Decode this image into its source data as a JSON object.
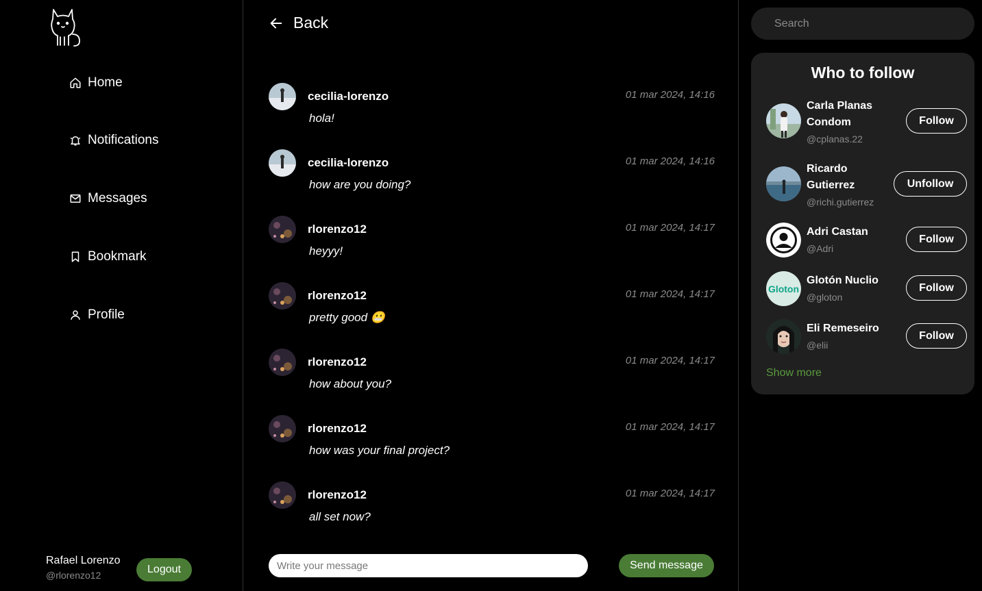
{
  "sidebar": {
    "nav": [
      {
        "label": "Home",
        "icon": "home-icon"
      },
      {
        "label": "Notifications",
        "icon": "bell-icon"
      },
      {
        "label": "Messages",
        "icon": "envelope-icon"
      },
      {
        "label": "Bookmark",
        "icon": "bookmark-icon"
      },
      {
        "label": "Profile",
        "icon": "user-icon"
      }
    ],
    "user": {
      "name": "Rafael Lorenzo",
      "handle": "@rlorenzo12"
    },
    "logout_label": "Logout"
  },
  "chat": {
    "back_label": "Back",
    "messages": [
      {
        "author": "cecilia-lorenzo",
        "time": "01 mar 2024, 14:16",
        "text": "hola!"
      },
      {
        "author": "cecilia-lorenzo",
        "time": "01 mar 2024, 14:16",
        "text": "how are you doing?"
      },
      {
        "author": "rlorenzo12",
        "time": "01 mar 2024, 14:17",
        "text": "heyyy!"
      },
      {
        "author": "rlorenzo12",
        "time": "01 mar 2024, 14:17",
        "text": "pretty good 😬"
      },
      {
        "author": "rlorenzo12",
        "time": "01 mar 2024, 14:17",
        "text": "how about you?"
      },
      {
        "author": "rlorenzo12",
        "time": "01 mar 2024, 14:17",
        "text": "how was your final project?"
      },
      {
        "author": "rlorenzo12",
        "time": "01 mar 2024, 14:17",
        "text": "all set now?"
      }
    ],
    "composer_placeholder": "Write your message",
    "send_label": "Send message"
  },
  "right": {
    "search_placeholder": "Search",
    "who_to_follow_title": "Who to follow",
    "suggestions": [
      {
        "name_line1": "Carla Planas",
        "name_line2": "Condom",
        "handle": "@cplanas.22",
        "button": "Follow"
      },
      {
        "name_line1": "Ricardo",
        "name_line2": "Gutierrez",
        "handle": "@richi.gutierrez",
        "button": "Unfollow"
      },
      {
        "name_line1": "Adri Castan",
        "name_line2": "",
        "handle": "@Adri",
        "button": "Follow"
      },
      {
        "name_line1": "Glotón Nuclio",
        "name_line2": "",
        "handle": "@gloton",
        "button": "Follow",
        "avatar_text": "Gloton"
      },
      {
        "name_line1": "Eli Remeseiro",
        "name_line2": "",
        "handle": "@elii",
        "button": "Follow"
      }
    ],
    "show_more_label": "Show more"
  },
  "colors": {
    "accent": "#4a7c36",
    "link": "#5a9a3e",
    "panel": "#202020"
  }
}
